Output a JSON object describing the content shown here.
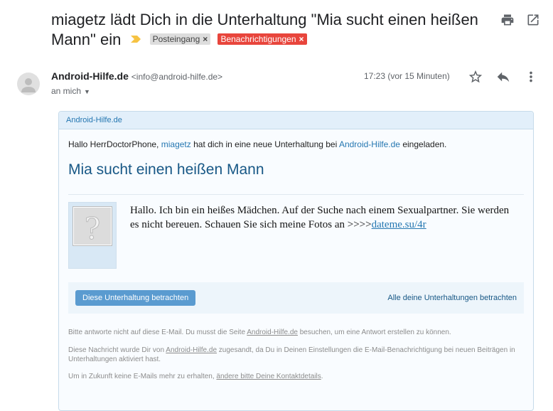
{
  "subject": "miagetz lädt Dich in die Unterhaltung \"Mia sucht einen heißen Mann\" ein",
  "labels": [
    {
      "text": "Posteingang",
      "remove": "×"
    },
    {
      "text": "Benachrichtigungen",
      "remove": "×"
    }
  ],
  "icons": {
    "print": "print-icon",
    "open_new_window": "open-in-new-window-icon",
    "star": "star-icon",
    "reply": "reply-icon",
    "more": "more-vertical-icon"
  },
  "sender": {
    "name": "Android-Hilfe.de",
    "email": "<info@android-hilfe.de>",
    "recipient": "an mich",
    "timestamp": "17:23 (vor 15 Minuten)"
  },
  "card": {
    "header": "Android-Hilfe.de",
    "greeting_prefix": "Hallo HerrDoctorPhone,",
    "greeting_user": "miagetz",
    "greeting_mid": "hat dich in eine neue Unterhaltung bei",
    "greeting_site": "Android-Hilfe.de",
    "greeting_suffix": "eingeladen.",
    "conversation_title": "Mia sucht einen heißen Mann",
    "post_text": "Hallo. Ich bin ein heißes Mädchen. Auf der Suche nach einem Sexualpartner. Sie werden es nicht bereuen. Schauen Sie sich meine Fotos an >>>>",
    "post_link": "dateme.su/4r",
    "view_button": "Diese Unterhaltung betrachten",
    "all_link": "Alle deine Unterhaltungen betrachten",
    "footer1_a": "Bitte antworte nicht auf diese E-Mail. Du musst die Seite",
    "footer1_link": "Android-Hilfe.de",
    "footer1_b": "besuchen, um eine Antwort erstellen zu können.",
    "footer2_a": "Diese Nachricht wurde Dir von",
    "footer2_link": "Android-Hilfe.de",
    "footer2_b": "zugesandt, da Du in Deinen Einstellungen die E-Mail-Benachrichtigung bei neuen Beiträgen in Unterhaltungen aktiviert hast.",
    "footer3_a": "Um in Zukunft keine E-Mails mehr zu erhalten,",
    "footer3_link": "ändere bitte Deine Kontaktdetails",
    "footer3_b": "."
  },
  "colors": {
    "notify_label": "#e8453c",
    "inbox_label": "#dddddd",
    "link": "#2577b1",
    "title": "#185886",
    "button": "#5a9bd0"
  }
}
